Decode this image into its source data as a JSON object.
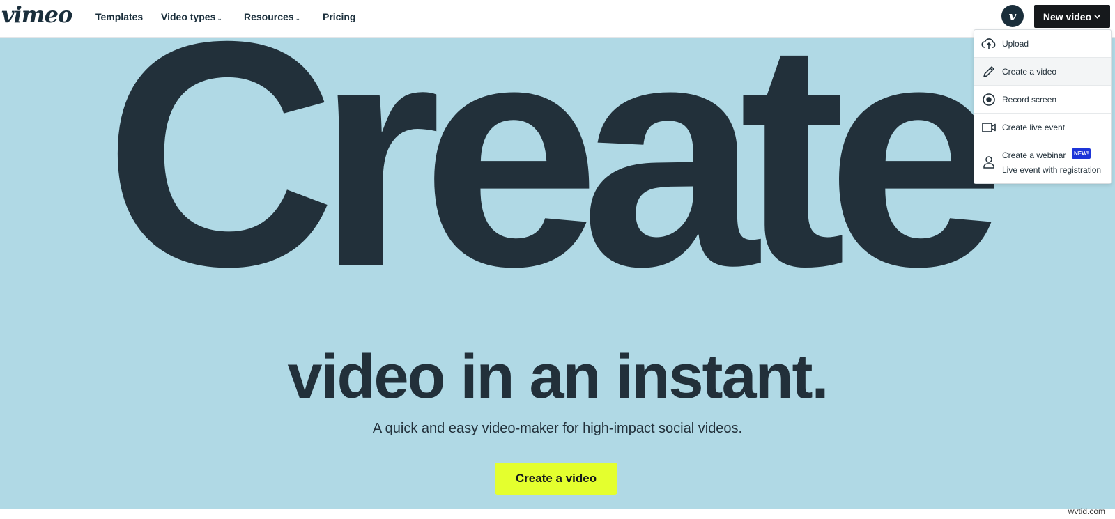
{
  "header": {
    "logo": "vimeo",
    "nav": [
      {
        "label": "Templates",
        "caret": ""
      },
      {
        "label": "Video types",
        "caret": "⌄"
      },
      {
        "label": "Resources",
        "caret": "⌄"
      },
      {
        "label": "Pricing",
        "caret": ""
      }
    ],
    "avatar_letter": "v",
    "new_video_label": "New video"
  },
  "dropdown": {
    "items": [
      {
        "label": "Upload",
        "icon": "cloud-upload-icon"
      },
      {
        "label": "Create a video",
        "icon": "pencil-icon"
      },
      {
        "label": "Record screen",
        "icon": "record-icon"
      },
      {
        "label": "Create live event",
        "icon": "video-camera-icon"
      }
    ],
    "webinar": {
      "label": "Create a webinar",
      "badge": "NEW!",
      "sublabel": "Live event with registration",
      "icon": "person-icon"
    }
  },
  "hero": {
    "big_word": "Create",
    "headline": "video in an instant.",
    "subline": "A quick and easy video-maker for high-impact social videos.",
    "cta_label": "Create a video",
    "watermark": "wvtid.com"
  },
  "colors": {
    "hero_bg": "#b0d9e5",
    "text_dark": "#22303a",
    "cta_bg": "#e4ff2e",
    "button_dark": "#16191c",
    "badge_blue": "#1d35d8"
  }
}
